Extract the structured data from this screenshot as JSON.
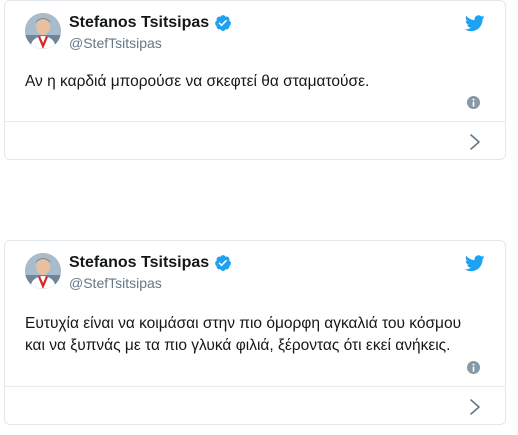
{
  "tweets": [
    {
      "author_name": "Stefanos Tsitsipas",
      "handle": "@StefTsitsipas",
      "text_lines": [
        "Αν η καρδιά μπορούσε να σκεφτεί θα σταματούσε."
      ],
      "verified": true
    },
    {
      "author_name": "Stefanos Tsitsipas",
      "handle": "@StefTsitsipas",
      "text_lines": [
        "Ευτυχία είναι να κοιμάσαι στην πιο όμορφη αγκαλιά του κόσμου",
        "και να ξυπνάς με τα πιο γλυκά φιλιά, ξέροντας ότι εκεί ανήκεις."
      ],
      "verified": true
    }
  ],
  "icons": {
    "brand": "twitter-bird-icon",
    "verified": "verified-badge-icon",
    "info": "info-icon",
    "expand": "chevron-right-icon"
  },
  "colors": {
    "twitter_blue": "#1da1f2",
    "text": "#14171a",
    "secondary_text": "#657786",
    "border": "#e1e8ed",
    "icon_gray": "#8899a6"
  }
}
